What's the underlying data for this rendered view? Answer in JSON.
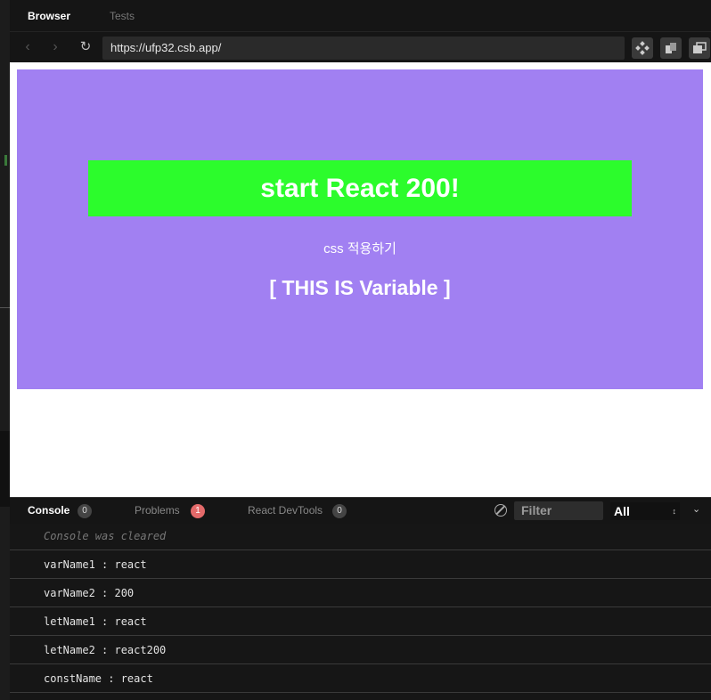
{
  "panel_tabs": {
    "browser": "Browser",
    "tests": "Tests"
  },
  "navbar": {
    "url": "https://ufp32.csb.app/"
  },
  "app": {
    "heading": "start React 200!",
    "subtitle": "css 적용하기",
    "variable_text": "[ THIS IS Variable ]",
    "colors": {
      "background": "#a180f2",
      "heading_bg": "#2cfc2c"
    }
  },
  "console": {
    "tabs": [
      {
        "label": "Console",
        "count": "0"
      },
      {
        "label": "Problems",
        "count": "1"
      },
      {
        "label": "React DevTools",
        "count": "0"
      }
    ],
    "filter_placeholder": "Filter",
    "level": "All",
    "cleared_message": "Console was cleared",
    "logs": [
      "varName1 : react",
      "varName2 : 200",
      "letName1 : react",
      "letName2 : react200",
      "constName : react"
    ]
  }
}
